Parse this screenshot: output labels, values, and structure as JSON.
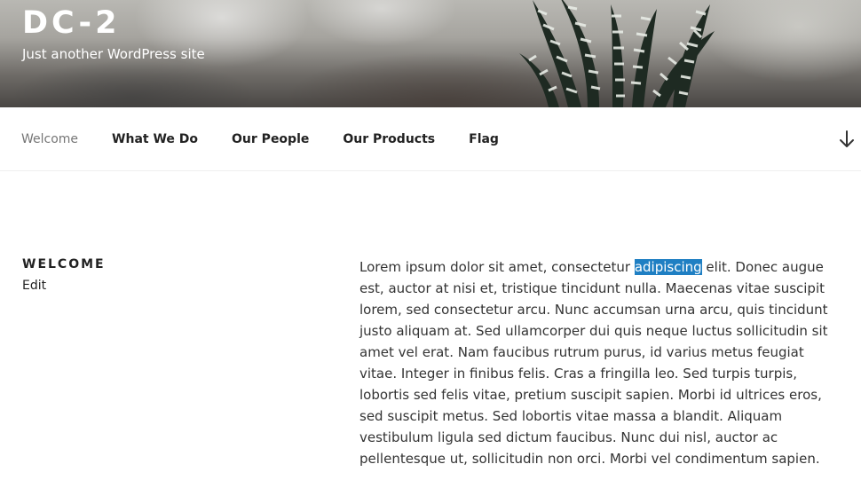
{
  "site": {
    "title": "DC-2",
    "tagline": "Just another WordPress site"
  },
  "nav": {
    "items": [
      {
        "label": "Welcome",
        "current": true
      },
      {
        "label": "What We Do",
        "current": false
      },
      {
        "label": "Our People",
        "current": false
      },
      {
        "label": "Our Products",
        "current": false
      },
      {
        "label": "Flag",
        "current": false
      }
    ],
    "scroll_icon": "arrow-down-icon"
  },
  "entry": {
    "title": "Welcome",
    "edit_label": "Edit",
    "text_before": "Lorem ipsum dolor sit amet, consectetur ",
    "text_selected": "adipiscing",
    "text_after": " elit. Donec augue est, auctor at nisi et, tristique tincidunt nulla. Maecenas vitae suscipit lorem, sed consectetur arcu. Nunc accumsan urna arcu, quis tincidunt justo aliquam at. Sed ullamcorper dui quis neque luctus sollicitudin sit amet vel erat. Nam faucibus rutrum purus, id varius metus feugiat vitae. Integer in finibus felis. Cras a fringilla leo. Sed turpis turpis, lobortis sed felis vitae, pretium suscipit sapien. Morbi id ultrices eros, sed suscipit metus. Sed lobortis vitae massa a blandit. Aliquam vestibulum ligula sed dictum faucibus. Nunc dui nisl, auctor ac pellentesque ut, sollicitudin non orci. Morbi vel condimentum sapien."
  },
  "colors": {
    "selection": "#1f7fc3",
    "nav_current": "#767676",
    "text": "#333333"
  }
}
